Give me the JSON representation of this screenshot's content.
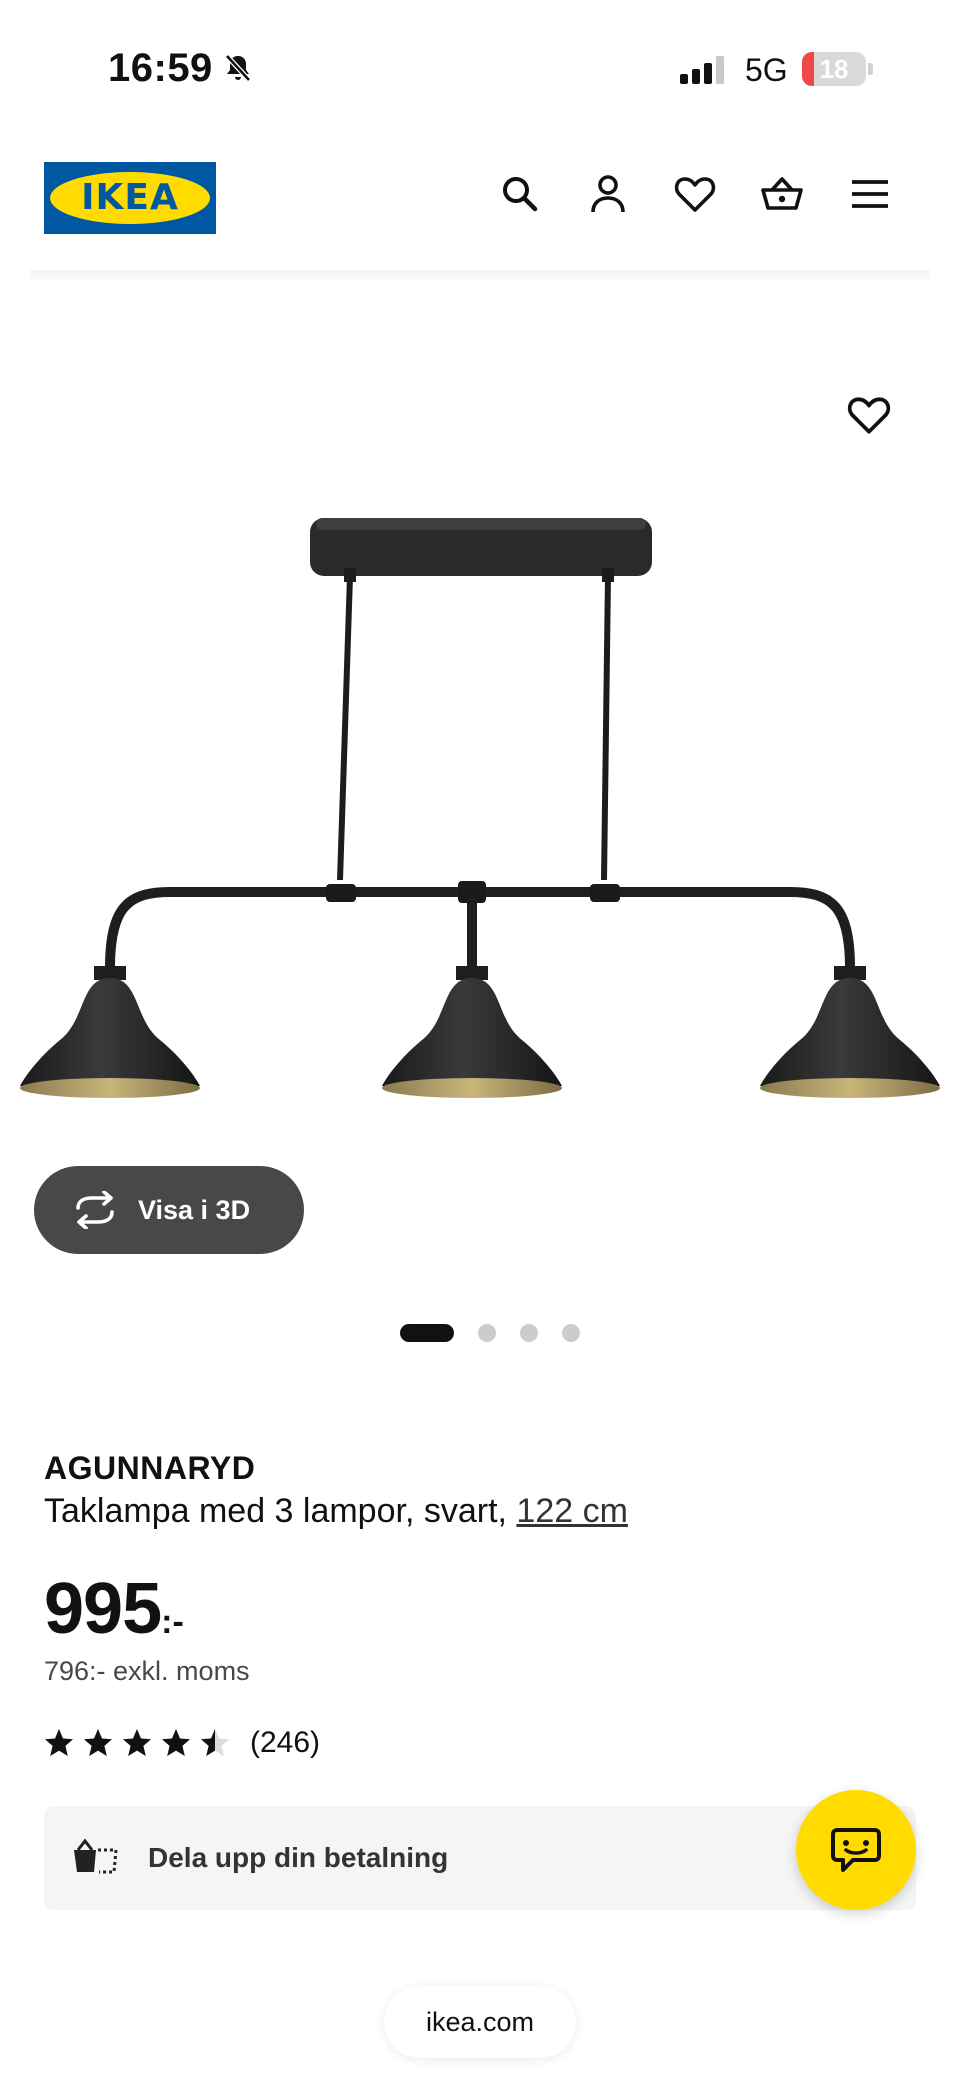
{
  "status_bar": {
    "time": "16:59",
    "network": "5G",
    "battery": "18",
    "battery_level": 0.18
  },
  "header": {
    "logo_text": "IKEA",
    "icons": [
      "search-icon",
      "user-icon",
      "heart-icon",
      "basket-icon",
      "menu-icon"
    ]
  },
  "gallery": {
    "view_3d_label": "Visa i 3D",
    "image_count": 4,
    "active_index": 0
  },
  "product": {
    "name": "AGUNNARYD",
    "description": "Taklampa med 3 lampor, svart,",
    "size_link": "122 cm",
    "price": "995",
    "price_suffix": ":-",
    "price_excl": "796:- exkl. moms",
    "rating_value": 4.5,
    "rating_max": 5,
    "rating_count": "(246)"
  },
  "payment": {
    "label": "Dela upp din betalning"
  },
  "browser": {
    "url": "ikea.com"
  },
  "colors": {
    "ikea_blue": "#0058a3",
    "ikea_yellow": "#ffdb00",
    "button_dark": "#484848"
  }
}
